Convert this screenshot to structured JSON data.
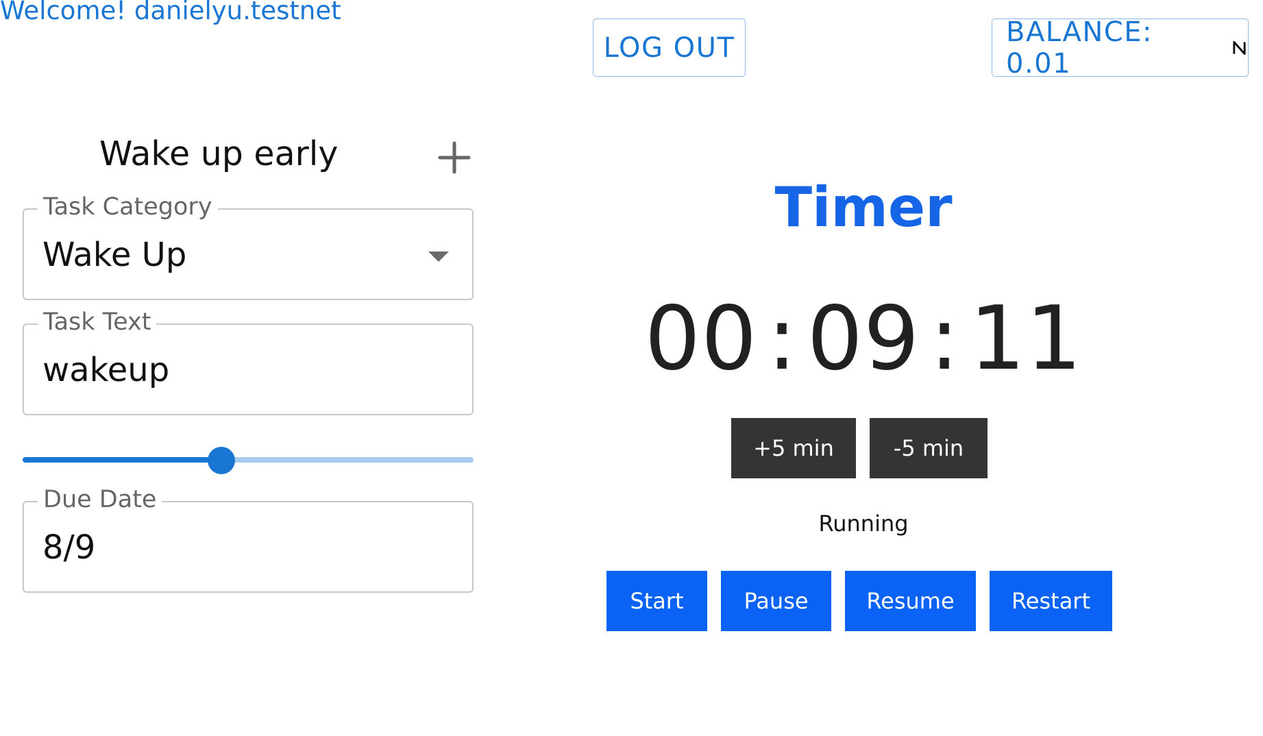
{
  "header": {
    "welcome": "Welcome! danielyu.testnet",
    "logout_label": "LOG OUT",
    "balance_label": "BALANCE: 0.01",
    "balance_icon": "near-logo-icon"
  },
  "task_form": {
    "title": "Wake up early",
    "add_icon": "plus-icon",
    "category": {
      "label": "Task Category",
      "value": "Wake Up"
    },
    "text": {
      "label": "Task Text",
      "value": "wakeup"
    },
    "slider": {
      "value_fraction": 0.44
    },
    "due_date": {
      "label": "Due Date",
      "value": "8/9"
    }
  },
  "timer": {
    "title": "Timer",
    "hours": "00",
    "minutes": "09",
    "seconds": "11",
    "separator": ":",
    "plus_label": "+5 min",
    "minus_label": "-5 min",
    "status": "Running",
    "buttons": {
      "start": "Start",
      "pause": "Pause",
      "resume": "Resume",
      "restart": "Restart"
    }
  },
  "colors": {
    "primary": "#1976d2",
    "timer_title": "#1565e6",
    "action_button": "#0b63f6",
    "dark_button": "#343434"
  }
}
